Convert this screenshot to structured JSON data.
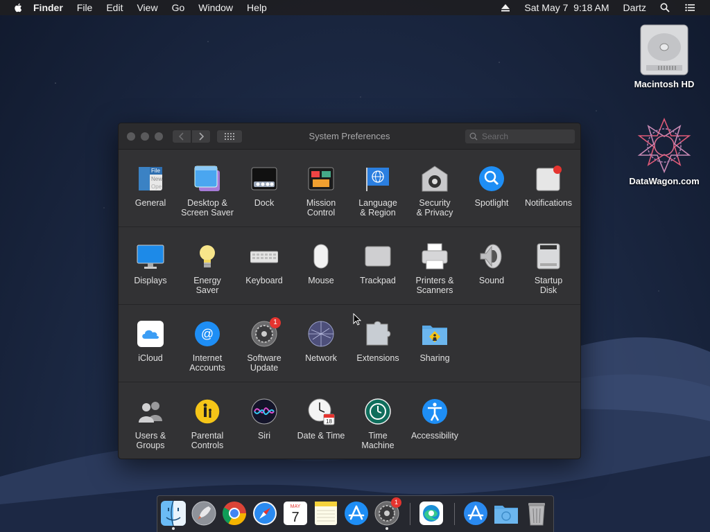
{
  "menubar": {
    "app_name": "Finder",
    "menus": [
      "File",
      "Edit",
      "View",
      "Go",
      "Window",
      "Help"
    ],
    "datetime": "Sat May 7  9:18 AM",
    "user": "Dartz"
  },
  "desktop": {
    "items": [
      {
        "label": "Macintosh HD",
        "icon": "hard-drive-icon"
      },
      {
        "label": "DataWagon.com",
        "icon": "datawagon-logo-icon"
      }
    ]
  },
  "window": {
    "title": "System Preferences",
    "search_placeholder": "Search",
    "rows": [
      [
        {
          "label": "General",
          "icon": "general-icon"
        },
        {
          "label": "Desktop &\nScreen Saver",
          "icon": "desktop-screensaver-icon"
        },
        {
          "label": "Dock",
          "icon": "dock-icon"
        },
        {
          "label": "Mission\nControl",
          "icon": "mission-control-icon"
        },
        {
          "label": "Language\n& Region",
          "icon": "language-region-icon"
        },
        {
          "label": "Security\n& Privacy",
          "icon": "security-privacy-icon"
        },
        {
          "label": "Spotlight",
          "icon": "spotlight-icon"
        },
        {
          "label": "Notifications",
          "icon": "notifications-icon"
        }
      ],
      [
        {
          "label": "Displays",
          "icon": "displays-icon"
        },
        {
          "label": "Energy\nSaver",
          "icon": "energy-saver-icon"
        },
        {
          "label": "Keyboard",
          "icon": "keyboard-icon"
        },
        {
          "label": "Mouse",
          "icon": "mouse-icon"
        },
        {
          "label": "Trackpad",
          "icon": "trackpad-icon"
        },
        {
          "label": "Printers &\nScanners",
          "icon": "printer-icon"
        },
        {
          "label": "Sound",
          "icon": "sound-icon"
        },
        {
          "label": "Startup\nDisk",
          "icon": "startup-disk-icon"
        }
      ],
      [
        {
          "label": "iCloud",
          "icon": "icloud-icon"
        },
        {
          "label": "Internet\nAccounts",
          "icon": "internet-accounts-icon"
        },
        {
          "label": "Software\nUpdate",
          "icon": "software-update-icon",
          "badge": "1"
        },
        {
          "label": "Network",
          "icon": "network-icon"
        },
        {
          "label": "Extensions",
          "icon": "extensions-icon"
        },
        {
          "label": "Sharing",
          "icon": "sharing-icon"
        }
      ],
      [
        {
          "label": "Users &\nGroups",
          "icon": "users-groups-icon"
        },
        {
          "label": "Parental\nControls",
          "icon": "parental-controls-icon"
        },
        {
          "label": "Siri",
          "icon": "siri-icon"
        },
        {
          "label": "Date & Time",
          "icon": "date-time-icon"
        },
        {
          "label": "Time\nMachine",
          "icon": "time-machine-icon"
        },
        {
          "label": "Accessibility",
          "icon": "accessibility-icon"
        }
      ]
    ]
  },
  "dock": {
    "items": [
      {
        "name": "finder",
        "icon": "finder-icon",
        "running": true
      },
      {
        "name": "launchpad",
        "icon": "launchpad-icon"
      },
      {
        "name": "chrome",
        "icon": "chrome-icon"
      },
      {
        "name": "safari",
        "icon": "safari-icon"
      },
      {
        "name": "calendar",
        "icon": "calendar-icon",
        "month": "MAY",
        "day": "7"
      },
      {
        "name": "notes",
        "icon": "notes-icon"
      },
      {
        "name": "app-store",
        "icon": "app-store-icon"
      },
      {
        "name": "system-preferences",
        "icon": "system-preferences-icon",
        "running": true,
        "badge": "1"
      },
      {
        "name": "edge",
        "icon": "edge-icon"
      },
      {
        "name": "applications",
        "icon": "applications-folder-icon"
      },
      {
        "name": "downloads",
        "icon": "downloads-folder-icon"
      },
      {
        "name": "trash",
        "icon": "trash-icon"
      }
    ]
  },
  "colors": {
    "window_bg": "#323234",
    "badge_red": "#e5342f",
    "accent_blue": "#1e8ef5"
  }
}
